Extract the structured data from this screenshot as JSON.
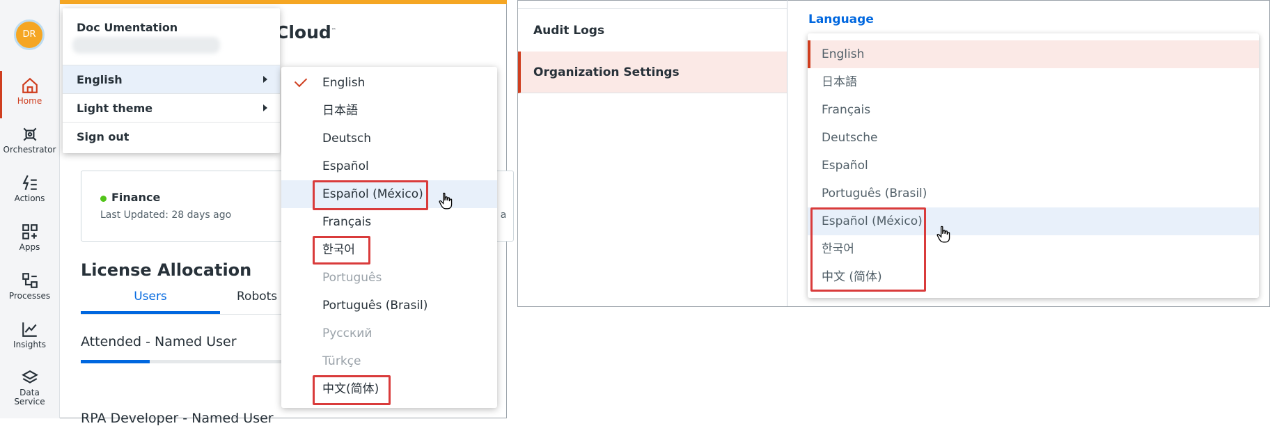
{
  "left_panel": {
    "user": {
      "avatar_initials": "DR",
      "name": "Doc Umentation"
    },
    "nav": [
      {
        "label": "Home",
        "icon": "home-icon"
      },
      {
        "label": "Orchestrator",
        "icon": "orchestrator-icon"
      },
      {
        "label": "Actions",
        "icon": "actions-icon"
      },
      {
        "label": "Apps",
        "icon": "apps-icon"
      },
      {
        "label": "Processes",
        "icon": "processes-icon"
      },
      {
        "label": "Insights",
        "icon": "insights-icon"
      },
      {
        "label": "Data",
        "label2": "Service",
        "icon": "data-service-icon"
      }
    ],
    "logo_text": "Cloud",
    "logo_tm": "™",
    "user_menu": {
      "language": "English",
      "theme": "Light theme",
      "sign_out": "Sign out"
    },
    "language_options": [
      {
        "label": "English",
        "checked": true
      },
      {
        "label": "日本語"
      },
      {
        "label": "Deutsch"
      },
      {
        "label": "Español"
      },
      {
        "label": "Español (México)",
        "highlighted": true
      },
      {
        "label": "Français"
      },
      {
        "label": "한국어",
        "highlighted": true
      },
      {
        "label": "Português",
        "disabled": true
      },
      {
        "label": "Português (Brasil)"
      },
      {
        "label": "Русский",
        "disabled": true
      },
      {
        "label": "Türkçe",
        "disabled": true
      },
      {
        "label": "中文(简体)",
        "highlighted": true
      }
    ],
    "tenant_card": {
      "status_color": "#52c41a",
      "name": "Finance",
      "last_updated": "Last Updated: 28 days ago",
      "truncated": "s a"
    },
    "license_title": "License Allocation",
    "tabs": {
      "users": "Users",
      "robots": "Robots"
    },
    "attended_label": "Attended - Named User",
    "attended_progress_fraction": 0.33,
    "rpa_label": "RPA Developer - Named User"
  },
  "right_panel": {
    "nav": [
      {
        "label": "Audit Logs"
      },
      {
        "label": "Organization Settings",
        "active": true
      }
    ],
    "language_label": "Language",
    "options": [
      {
        "label": "English",
        "selected": true
      },
      {
        "label": "日本語"
      },
      {
        "label": "Français"
      },
      {
        "label": "Deutsche"
      },
      {
        "label": "Español"
      },
      {
        "label": "Português (Brasil)"
      },
      {
        "label": "Español (México)",
        "hovered": true
      },
      {
        "label": "한국어"
      },
      {
        "label": "中文 (简体)"
      }
    ]
  },
  "colors": {
    "accent": "#cf3e1f",
    "link": "#0067df",
    "highlight_box": "#d93b3b",
    "top_bar": "#f5a623"
  }
}
